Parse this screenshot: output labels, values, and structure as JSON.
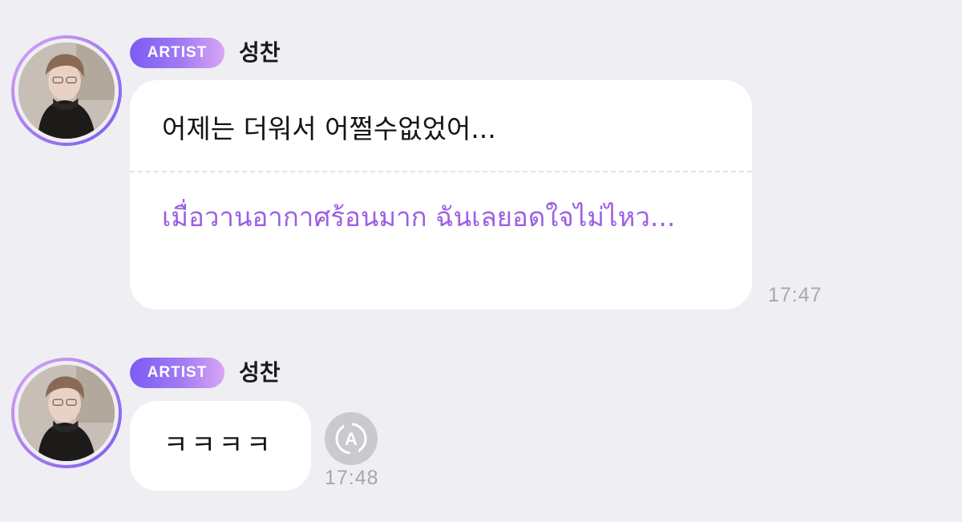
{
  "messages": [
    {
      "badge": "ARTIST",
      "name": "성찬",
      "text": "어제는 더워서 어쩔수없었어...",
      "translation": "เมื่อวานอากาศร้อนมาก ฉันเลยอดใจไม่ไหว...",
      "time": "17:47"
    },
    {
      "badge": "ARTIST",
      "name": "성찬",
      "text": "ㅋㅋㅋㅋ",
      "time": "17:48",
      "translate_icon": "translate-A-icon"
    }
  ],
  "colors": {
    "background": "#efeef2",
    "translation_text": "#9c5fe4",
    "badge_gradient_start": "#7b5cf5",
    "badge_gradient_end": "#d7a6f3",
    "timestamp": "#a7a7ad"
  }
}
